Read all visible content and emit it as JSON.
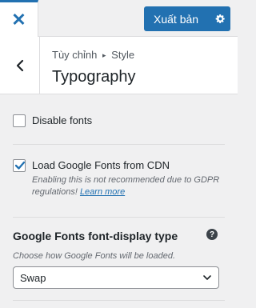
{
  "topbar": {
    "close_icon": "close-icon",
    "publish_label": "Xuất bản",
    "settings_icon": "gear-icon",
    "accent_color": "#2271b1"
  },
  "header": {
    "breadcrumb_parent": "Tùy chỉnh",
    "breadcrumb_sep": "▸",
    "breadcrumb_section": "Style",
    "title": "Typography",
    "back_icon": "chevron-left-icon"
  },
  "options": {
    "disable_fonts": {
      "label": "Disable fonts",
      "checked": false
    },
    "load_cdn": {
      "label": "Load Google Fonts from CDN",
      "checked": true,
      "description": "Enabling this is not recommended due to GDPR regulations!",
      "learn_more": "Learn more"
    }
  },
  "font_display": {
    "title": "Google Fonts font-display type",
    "help_icon": "?",
    "description": "Choose how Google Fonts will be loaded.",
    "selected": "Swap"
  }
}
